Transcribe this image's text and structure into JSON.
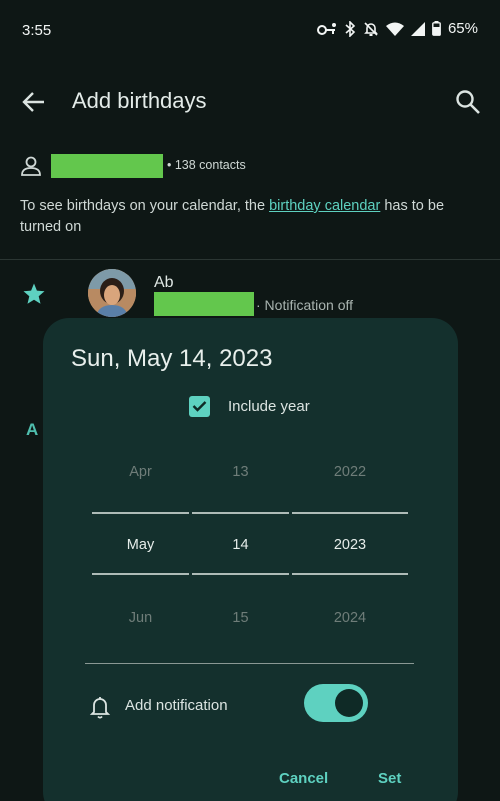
{
  "status_bar": {
    "time": "3:55",
    "battery": "65%",
    "icons": [
      "vpn-key-icon",
      "bluetooth-icon",
      "notifications-off-icon",
      "wifi-icon",
      "signal-icon",
      "battery-icon"
    ]
  },
  "app_bar": {
    "title": "Add birthdays",
    "back_icon": "arrow-back-icon",
    "search_icon": "search-icon"
  },
  "account": {
    "icon": "person-icon",
    "contacts_count": "• 138 contacts"
  },
  "info": {
    "text_before": "To see birthdays on your calendar, the ",
    "link": "birthday calendar",
    "text_after": " has to be turned on"
  },
  "contact": {
    "name": "Ab",
    "status": "· Notification off",
    "starred": true
  },
  "background_letter": "A",
  "dialog": {
    "date": "Sun, May 14, 2023",
    "include_year_label": "Include year",
    "include_year_checked": true,
    "month": {
      "prev": "Apr",
      "current": "May",
      "next": "Jun"
    },
    "day": {
      "prev": "13",
      "current": "14",
      "next": "15"
    },
    "year": {
      "prev": "2022",
      "current": "2023",
      "next": "2024"
    },
    "notification_label": "Add notification",
    "notification_on": true,
    "cancel_label": "Cancel",
    "set_label": "Set"
  },
  "colors": {
    "background": "#0e1715",
    "dialog": "#14302d",
    "accent": "#5ed1c0",
    "redaction": "#63c74d"
  }
}
